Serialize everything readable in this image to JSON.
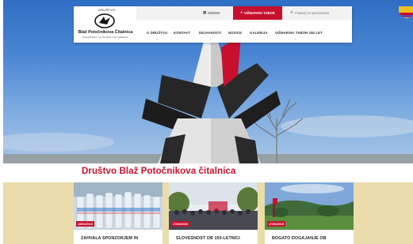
{
  "logo": {
    "top_text": "DRUŠTVO",
    "name": "Blaž Potočnikova Čitalnica",
    "subtitle": "Pripadnikom na Šentvid nad Ljubljano"
  },
  "topbar": {
    "calendar_text": "06/2020",
    "tabor_label": "VIŽMARSKI TABOR",
    "sponsors_label": "Postanj za sponzorstvo"
  },
  "nav": {
    "items": [
      {
        "label": "O DRUŠTVU"
      },
      {
        "label": "KONTAKT"
      },
      {
        "label": "DEJAVNOSTI"
      },
      {
        "label": "NOVICE"
      },
      {
        "label": "GALERIJA"
      },
      {
        "label": "VIŽMARSKI TABOR 150 LET"
      }
    ]
  },
  "site_title": "Društvo Blaž Potočnikova čitalnica",
  "news": [
    {
      "date": "18/06/2019",
      "title": "ZAHVALA SPONZORJEM IN"
    },
    {
      "date": "17/06/2019",
      "title": "SLOVESNOST OB 150-LETNICI"
    },
    {
      "date": "17/06/2019",
      "title": "BOGATO DOGAJANJE OB"
    }
  ],
  "colors": {
    "brand_red": "#c8102e",
    "news_background": "#eadcab",
    "sky_blue": "#3f7ccc"
  },
  "icons": {
    "calendar": "calendar-icon",
    "info": "info-icon",
    "gear": "gear-icon"
  }
}
